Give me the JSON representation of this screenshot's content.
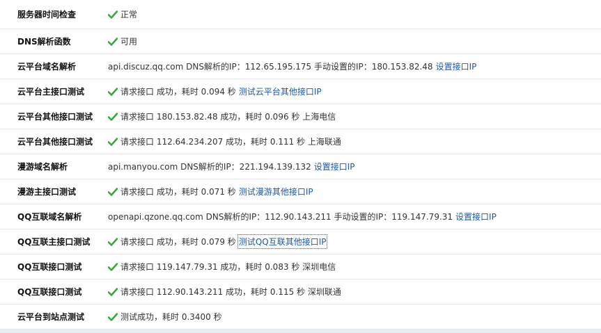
{
  "rows": [
    {
      "label": "服务器时间检查",
      "check": true,
      "text": "正常",
      "link": ""
    },
    {
      "label": "DNS解析函数",
      "check": true,
      "text": "可用",
      "link": ""
    },
    {
      "label": "云平台域名解析",
      "check": false,
      "text": "api.discuz.qq.com DNS解析的IP：112.65.195.175 手动设置的IP：180.153.82.48",
      "link": "设置接口IP"
    },
    {
      "label": "云平台主接口测试",
      "check": true,
      "text": "请求接口 成功，耗时 0.094 秒",
      "link": "测试云平台其他接口IP"
    },
    {
      "label": "云平台其他接口测试",
      "check": true,
      "text": "请求接口 180.153.82.48 成功，耗时 0.096 秒 上海电信",
      "link": ""
    },
    {
      "label": "云平台其他接口测试",
      "check": true,
      "text": "请求接口 112.64.234.207 成功，耗时 0.111 秒 上海联通",
      "link": ""
    },
    {
      "label": "漫游域名解析",
      "check": false,
      "text": "api.manyou.com DNS解析的IP：221.194.139.132",
      "link": "设置接口IP"
    },
    {
      "label": "漫游主接口测试",
      "check": true,
      "text": "请求接口 成功，耗时 0.071 秒",
      "link": "测试漫游其他接口IP"
    },
    {
      "label": "QQ互联域名解析",
      "check": false,
      "text": "openapi.qzone.qq.com DNS解析的IP：112.90.143.211 手动设置的IP：119.147.79.31",
      "link": "设置接口IP"
    },
    {
      "label": "QQ互联主接口测试",
      "check": true,
      "text": "请求接口 成功，耗时 0.079 秒",
      "link": "测试QQ互联其他接口IP",
      "link_focused": true
    },
    {
      "label": "QQ互联接口测试",
      "check": true,
      "text": "请求接口 119.147.79.31 成功，耗时 0.083 秒 深圳电信",
      "link": ""
    },
    {
      "label": "QQ互联接口测试",
      "check": true,
      "text": "请求接口 112.90.143.211 成功，耗时 0.115 秒 深圳联通",
      "link": ""
    },
    {
      "label": "云平台到站点测试",
      "check": true,
      "text": "测试成功，耗时 0.3400 秒",
      "link": ""
    }
  ],
  "colors": {
    "check": "#3ba63a",
    "link": "#1f57a4",
    "label": "#111111",
    "divider": "#e6e6e6"
  },
  "icons": {
    "ok": "check-icon"
  }
}
